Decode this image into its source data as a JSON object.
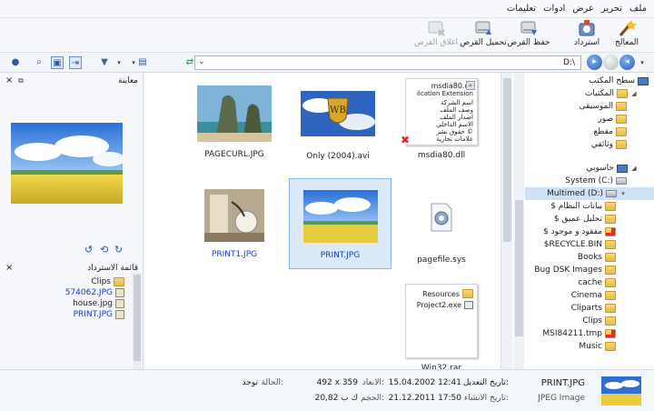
{
  "menu": [
    "ملف",
    "تحرير",
    "عرض",
    "ادوات",
    "تعليمات"
  ],
  "toolbar": {
    "wizard": "المعالج",
    "recover": "استرداد",
    "save_disk": "حفظ القرص",
    "load_disk": "تحميل القرص",
    "close_disk": "اغلاق القرص"
  },
  "address": {
    "path": "D:\\"
  },
  "left_pane": {
    "preview_title": "معاينة",
    "recovery_title": "قائمة الاسترداد",
    "recovery_items": [
      {
        "name": "Clips",
        "kind": "folder"
      },
      {
        "name": "574062.JPG",
        "kind": "file",
        "blue": true
      },
      {
        "name": "house.jpg",
        "kind": "file",
        "blue": false
      },
      {
        "name": "PRINT.JPG",
        "kind": "file",
        "blue": true
      }
    ]
  },
  "files": [
    {
      "name": "PAGECURL.JPG",
      "blue": false
    },
    {
      "name": "Only (2004).avi",
      "blue": false
    },
    {
      "name": "msdia80.dll",
      "blue": false
    },
    {
      "name": "PRINT1.JPG",
      "blue": true
    },
    {
      "name": "PRINT.JPG",
      "blue": true
    },
    {
      "name": "pagefile.sys",
      "blue": false
    },
    {
      "name": "Win32.rar",
      "blue": false
    }
  ],
  "dll_preview": {
    "title": "msdia80.dll",
    "subtitle": "ilcation Extension",
    "lines": [
      "اسم الشركة",
      "وصف الملف",
      "اصدار الملف",
      "الاسم الداخلي",
      "حقوق نشر ©",
      "علامات تجارية"
    ]
  },
  "rar_preview": {
    "items": [
      "Resources",
      "Project2.exe"
    ]
  },
  "tree": [
    {
      "label": "سطح المكتب",
      "level": 0
    },
    {
      "label": "المكتبات",
      "level": 1
    },
    {
      "label": "الموسيقى",
      "level": 2
    },
    {
      "label": "صور",
      "level": 2
    },
    {
      "label": "مقطع",
      "level": 2
    },
    {
      "label": "وثائقي",
      "level": 2
    },
    {
      "label": "حاسوبي",
      "level": 1
    },
    {
      "label": "System (C:)",
      "level": 2
    },
    {
      "label": "Multimed (D:)",
      "level": 2
    },
    {
      "label": "$ بيانات النظام",
      "level": 3
    },
    {
      "label": "$ تحليل عميق",
      "level": 3
    },
    {
      "label": "$ مفقود و موجود",
      "level": 3
    },
    {
      "label": "$RECYCLE.BIN",
      "level": 3
    },
    {
      "label": "Books",
      "level": 3
    },
    {
      "label": "Bug DSK Images",
      "level": 3
    },
    {
      "label": "cache",
      "level": 3
    },
    {
      "label": "Cinema",
      "level": 3
    },
    {
      "label": "Cliparts",
      "level": 3
    },
    {
      "label": "Clips",
      "level": 3
    },
    {
      "label": "MSI84211.tmp",
      "level": 3
    },
    {
      "label": "Music",
      "level": 3
    }
  ],
  "status": {
    "filename": "PRINT.JPG",
    "filetype": "JPEG Image",
    "modified_label": "تاريخ التعديل:",
    "modified_value": "15.04.2002 12:41",
    "created_label": "تاريخ الانشاء:",
    "created_value": "21.12.2011 17:50",
    "dims_label": "الابعاد:",
    "dims_value": "492 x 359",
    "size_label": "الحجم:",
    "size_value": "20,82 ك ب",
    "state_label": "الحالة:",
    "state_value": "توجد"
  }
}
